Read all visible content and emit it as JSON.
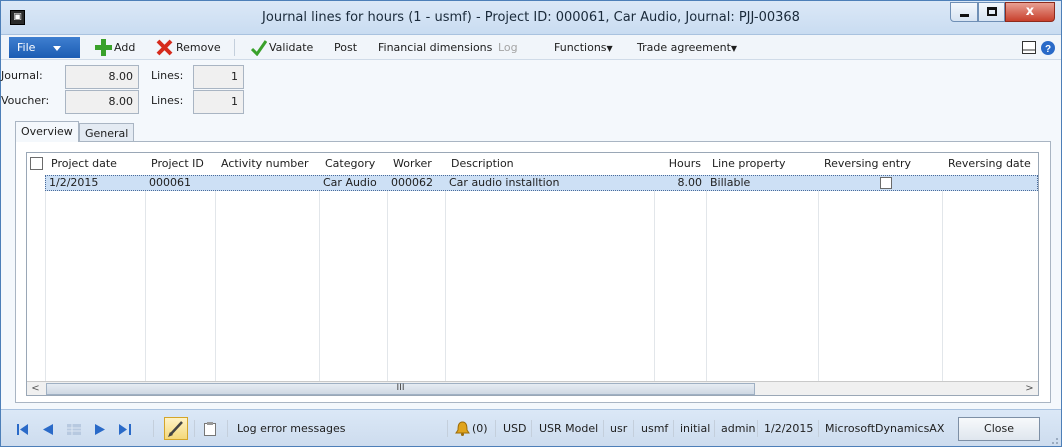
{
  "window": {
    "title": "Journal lines for hours (1 - usmf) - Project ID: 000061, Car Audio, Journal: PJJ-00368",
    "app_icon": "ax-window-icon",
    "close_glyph": "x"
  },
  "toolbar": {
    "file": "File",
    "add": "Add",
    "remove": "Remove",
    "validate": "Validate",
    "post": "Post",
    "financial_dimensions": "Financial dimensions",
    "log": "Log",
    "functions": "Functions",
    "trade_agreement": "Trade agreement",
    "dropdown_glyph": "▼"
  },
  "summary": {
    "journal_label": "Journal:",
    "journal_value": "8.00",
    "journal_lines_label": "Lines:",
    "journal_lines_value": "1",
    "voucher_label": "Voucher:",
    "voucher_value": "8.00",
    "voucher_lines_label": "Lines:",
    "voucher_lines_value": "1"
  },
  "tabs": [
    {
      "label": "Overview",
      "active": true
    },
    {
      "label": "General",
      "active": false
    }
  ],
  "grid": {
    "columns": [
      "Project date",
      "Project ID",
      "Activity number",
      "Category",
      "Worker",
      "Description",
      "Hours",
      "Line property",
      "Reversing entry",
      "Reversing date"
    ],
    "rows": [
      {
        "project_date": "1/2/2015",
        "project_id": "000061",
        "activity_number": "",
        "category": "Car Audio",
        "worker": "000062",
        "description": "Car audio installtion",
        "hours": "8.00",
        "line_property": "Billable",
        "reversing_entry": false,
        "reversing_date": ""
      }
    ],
    "scroll_left": "<",
    "scroll_right": ">",
    "scroll_grip": "III"
  },
  "status": {
    "log_error_messages": "Log error messages",
    "notifications": "(0)",
    "currency": "USD",
    "model": "USR Model",
    "layer": "usr",
    "company": "usmf",
    "partition": "initial",
    "user": "admin",
    "date": "1/2/2015",
    "instance": "MicrosoftDynamicsAX",
    "close": "Close"
  },
  "colors": {
    "selected_row": "#cde0f5",
    "file_button": "#1b5cb3",
    "title_bar": "#c9dcf1"
  }
}
